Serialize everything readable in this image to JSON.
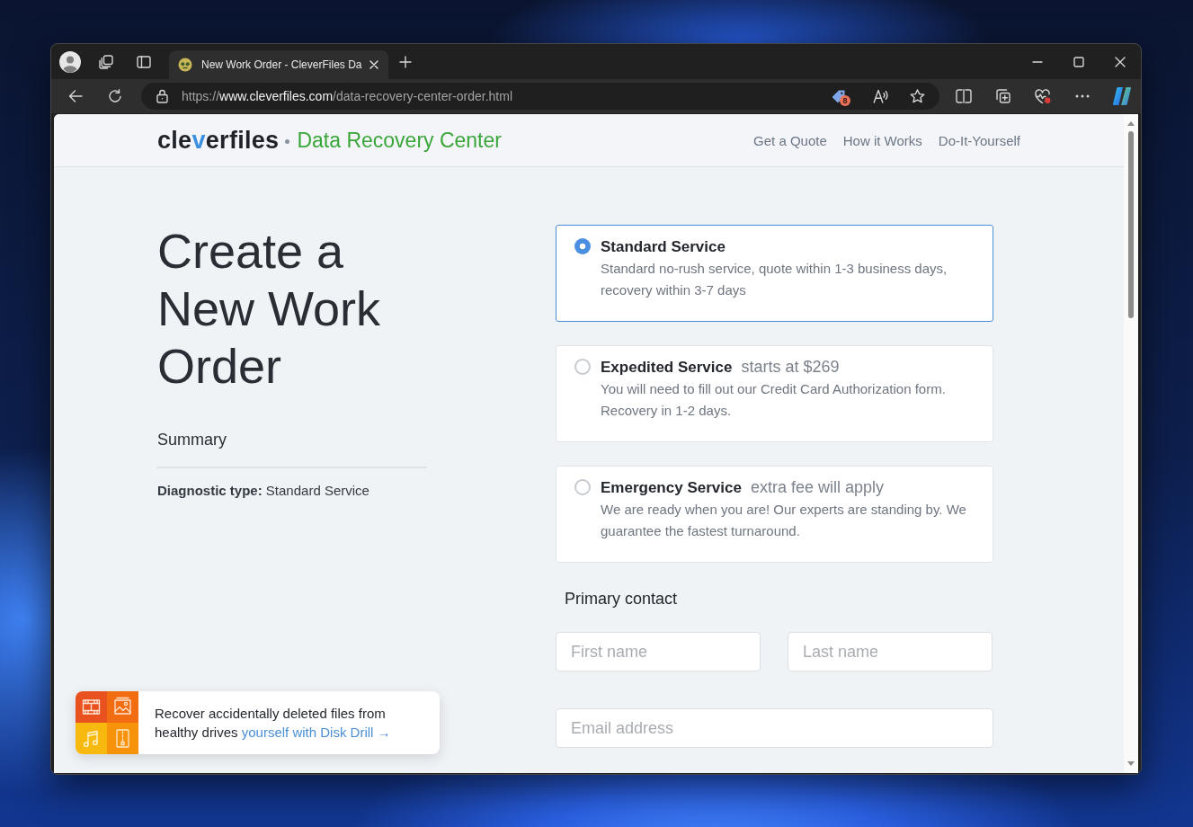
{
  "browser": {
    "tab": {
      "title": "New Work Order - CleverFiles Da",
      "selected": true
    },
    "url": {
      "scheme": "https://",
      "host": "www.cleverfiles.com",
      "path": "/data-recovery-center-order.html"
    },
    "extension_badge": "8"
  },
  "header": {
    "logo": "cleverfiles",
    "tagline": "Data Recovery Center",
    "nav": [
      "Get a Quote",
      "How it Works",
      "Do-It-Yourself"
    ]
  },
  "page": {
    "title": "Create a New Work Order",
    "summary": {
      "heading": "Summary",
      "line": "**Diagnostic type:** Standard Service"
    }
  },
  "services": [
    {
      "title": "Standard Service",
      "selected": true,
      "description": "Standard no-rush service, quote within 1-3 business days, recovery within 3-7 days"
    },
    {
      "title": "Expedited Service",
      "note": "starts at $269",
      "selected": false,
      "description": "You will need to fill out our Credit Card Authorization form. Recovery in 1-2 days."
    },
    {
      "title": "Emergency Service",
      "note": "extra fee will apply",
      "selected": false,
      "description": "We are ready when you are! Our experts are standing by. We guarantee the fastest turnaround."
    }
  ],
  "contact": {
    "heading": "Primary contact",
    "fields": [
      {
        "placeholder": "First name"
      },
      {
        "placeholder": "Last name"
      },
      {
        "placeholder": "Email address"
      }
    ]
  },
  "promo": {
    "text": "Recover accidentally deleted files from healthy drives",
    "link": "yourself with Disk Drill →"
  }
}
